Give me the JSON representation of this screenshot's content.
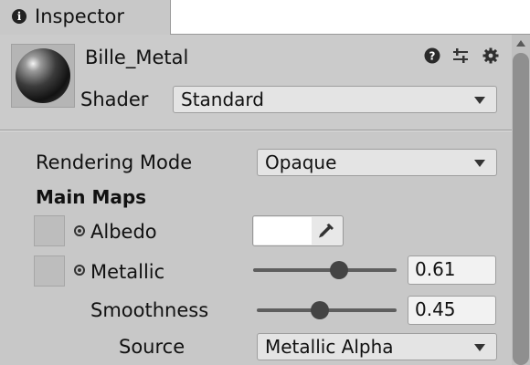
{
  "tab": {
    "label": "Inspector",
    "icon": "info-icon"
  },
  "header": {
    "material_name": "Bille_Metal",
    "shader_label": "Shader",
    "shader_value": "Standard",
    "icons": [
      "help-icon",
      "presets-icon",
      "gear-icon"
    ]
  },
  "properties": {
    "rendering_mode_label": "Rendering Mode",
    "rendering_mode_value": "Opaque",
    "section_title": "Main Maps",
    "albedo_label": "Albedo",
    "albedo_color": "#ffffff",
    "metallic_label": "Metallic",
    "metallic_value": "0.61",
    "smoothness_label": "Smoothness",
    "smoothness_value": "0.45",
    "source_label": "Source",
    "source_value": "Metallic Alpha"
  }
}
